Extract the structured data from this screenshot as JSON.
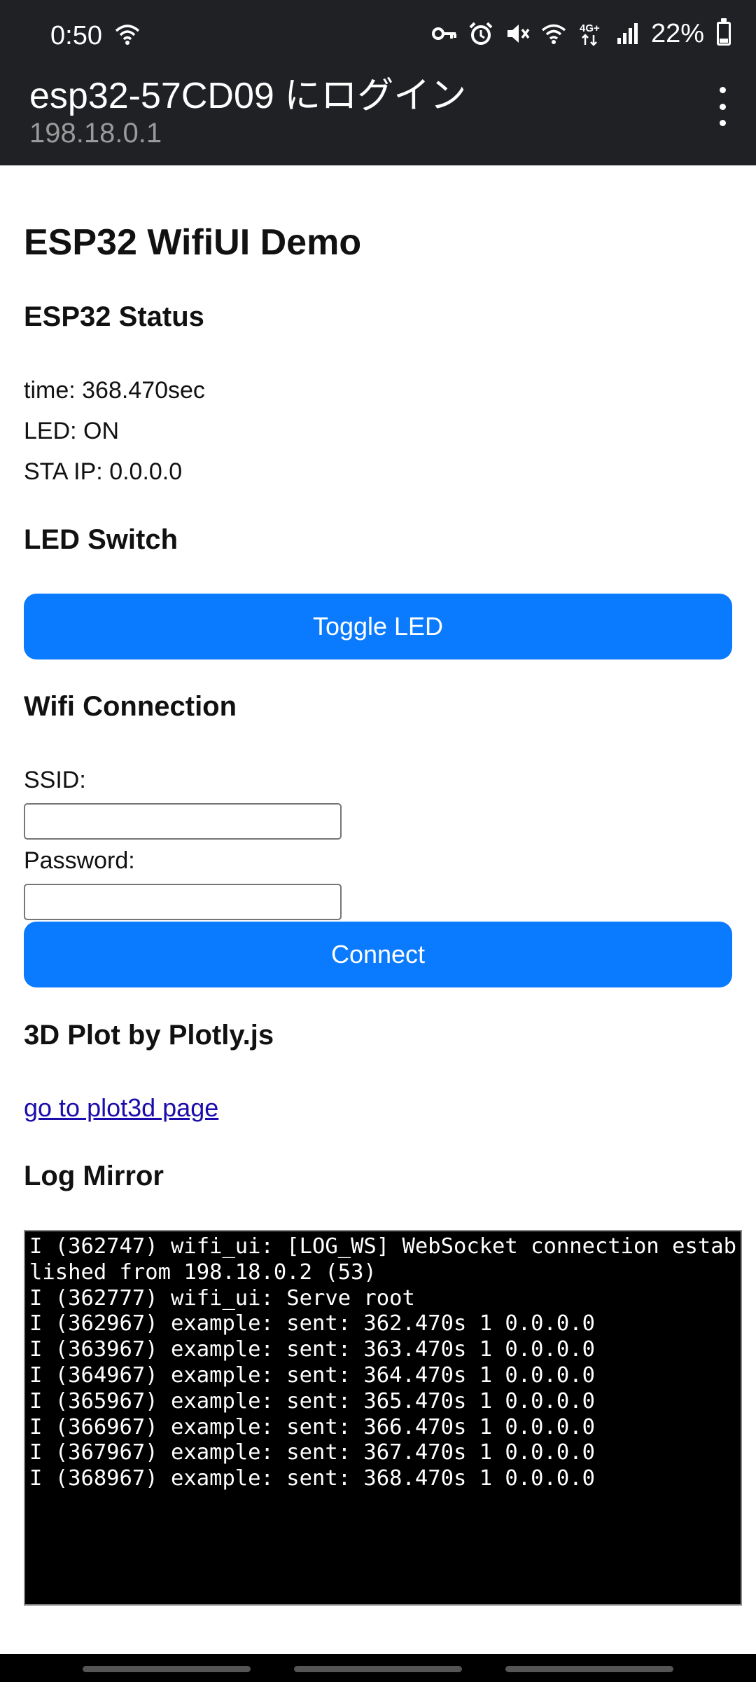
{
  "status_bar": {
    "time": "0:50",
    "battery_percent": "22%",
    "battery_level": 0.22,
    "network_label": "4G+",
    "icons": [
      "wifi-icon",
      "vpn-key-icon",
      "alarm-icon",
      "mute-icon",
      "wifi-icon",
      "mobile-data-icon",
      "signal-icon",
      "battery-icon"
    ]
  },
  "portal": {
    "title": "esp32-57CD09 にログイン",
    "subtitle": "198.18.0.1",
    "menu_icon": "more-vertical-icon"
  },
  "page": {
    "title": "ESP32 WifiUI Demo",
    "status_section": {
      "heading": "ESP32 Status",
      "time_line": "time: 368.470sec",
      "led_line": "LED: ON",
      "sta_ip_line": "STA IP: 0.0.0.0"
    },
    "led_section": {
      "heading": "LED Switch",
      "button_label": "Toggle LED"
    },
    "wifi_section": {
      "heading": "Wifi Connection",
      "ssid_label": "SSID:",
      "ssid_value": "",
      "password_label": "Password:",
      "password_value": "",
      "connect_label": "Connect"
    },
    "plot_section": {
      "heading": "3D Plot by Plotly.js",
      "link_text": "go to plot3d page"
    },
    "log_section": {
      "heading": "Log Mirror",
      "lines": [
        "I (362747) wifi_ui: [LOG_WS] WebSocket connection established from 198.18.0.2 (53)",
        "I (362777) wifi_ui: Serve root",
        "I (362967) example: sent: 362.470s 1 0.0.0.0",
        "I (363967) example: sent: 363.470s 1 0.0.0.0",
        "I (364967) example: sent: 364.470s 1 0.0.0.0",
        "I (365967) example: sent: 365.470s 1 0.0.0.0",
        "I (366967) example: sent: 366.470s 1 0.0.0.0",
        "I (367967) example: sent: 367.470s 1 0.0.0.0",
        "I (368967) example: sent: 368.470s 1 0.0.0.0"
      ]
    }
  }
}
